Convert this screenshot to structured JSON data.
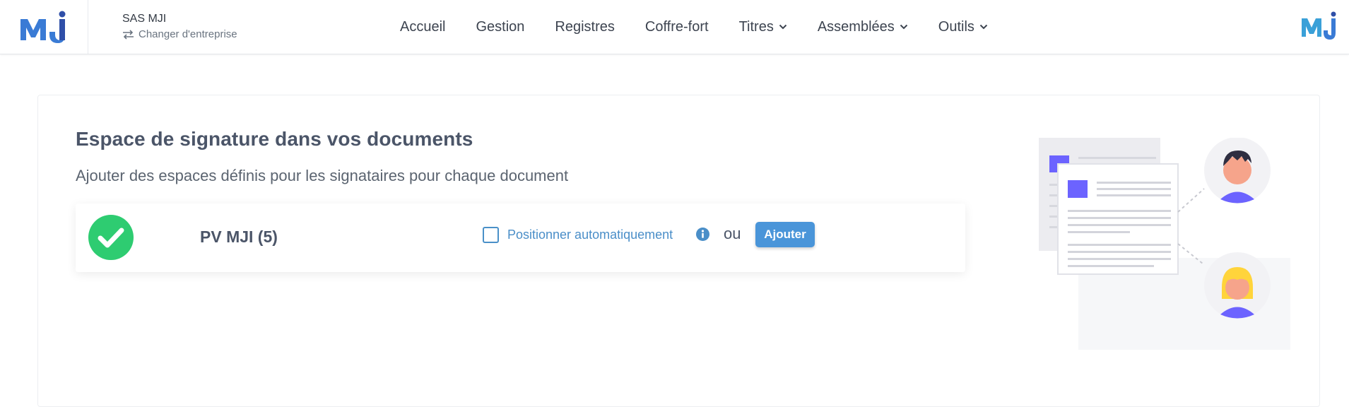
{
  "header": {
    "company_name": "SAS MJI",
    "switch_company_label": "Changer d'entreprise",
    "brand_logo_text": "MJi",
    "nav": [
      {
        "label": "Accueil",
        "dropdown": false
      },
      {
        "label": "Gestion",
        "dropdown": false
      },
      {
        "label": "Registres",
        "dropdown": false
      },
      {
        "label": "Coffre-fort",
        "dropdown": false
      },
      {
        "label": "Titres",
        "dropdown": true
      },
      {
        "label": "Assemblées",
        "dropdown": true
      },
      {
        "label": "Outils",
        "dropdown": true
      }
    ]
  },
  "main": {
    "title": "Espace de signature dans vos documents",
    "subtitle": "Ajouter des espaces définis pour les signataires pour chaque document",
    "documents": [
      {
        "name": "PV MJI (5)",
        "status_icon": "check-circle-icon",
        "auto_position_label": "Positionner automatiquement",
        "auto_position_checked": false,
        "or_label": "ou",
        "add_button_label": "Ajouter"
      }
    ]
  },
  "colors": {
    "brand_blue": "#3a6fc4",
    "success_green": "#2ecc71",
    "link_blue": "#4a8ec8",
    "button_blue": "#4a95d9",
    "illustration_purple": "#6c63ff"
  },
  "icons": [
    "switch-arrows-icon",
    "chevron-down-icon",
    "check-circle-icon",
    "info-icon"
  ]
}
